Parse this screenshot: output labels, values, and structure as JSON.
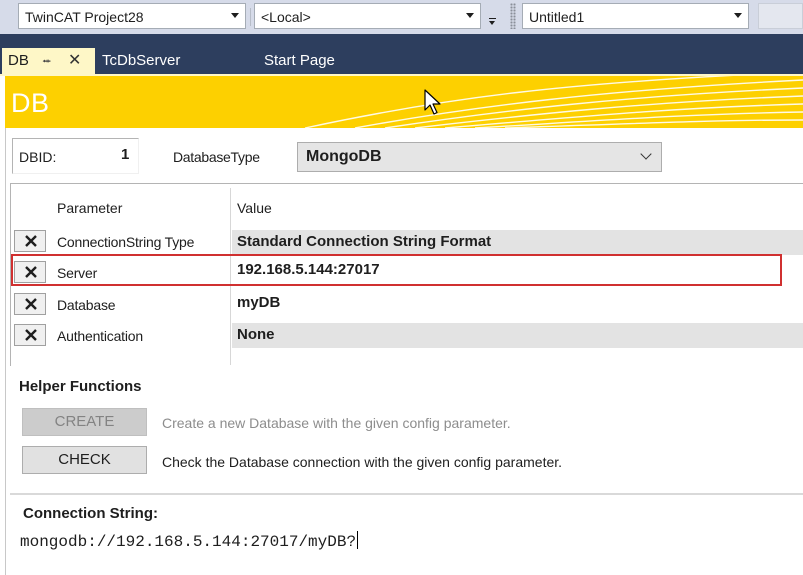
{
  "toolbar": {
    "project_combo": "TwinCAT Project28",
    "target_combo": "<Local>",
    "solution_combo": "Untitled1"
  },
  "tabs": [
    {
      "label": "DB",
      "active": true
    },
    {
      "label": "TcDbServer",
      "active": false
    },
    {
      "label": "Start Page",
      "active": false
    }
  ],
  "header": {
    "title": "DB",
    "color": "#fdd000"
  },
  "db": {
    "dbid_label": "DBID:",
    "dbid_value": "1",
    "type_label": "DatabaseType",
    "type_value": "MongoDB"
  },
  "grid": {
    "col_param": "Parameter",
    "col_value": "Value",
    "rows": [
      {
        "param": "ConnectionString Type",
        "value": "Standard Connection String Format"
      },
      {
        "param": "Server",
        "value": "192.168.5.144:27017"
      },
      {
        "param": "Database",
        "value": "myDB"
      },
      {
        "param": "Authentication",
        "value": "None"
      }
    ],
    "highlight_color": "#d03030"
  },
  "helper": {
    "title": "Helper Functions",
    "create_label": "CREATE",
    "create_desc": "Create a new Database with the given config parameter.",
    "check_label": "CHECK",
    "check_desc": "Check the Database connection with the given config parameter."
  },
  "connection": {
    "label": "Connection String:",
    "value": "mongodb://192.168.5.144:27017/myDB?"
  }
}
